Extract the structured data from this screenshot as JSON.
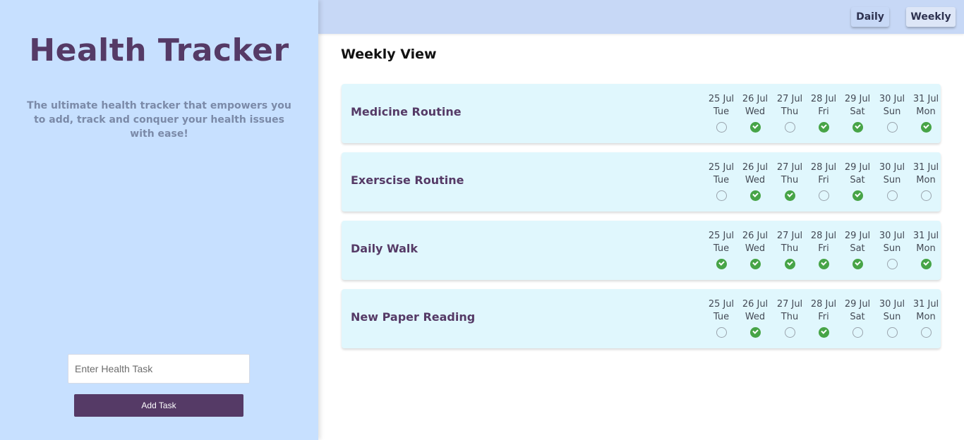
{
  "sidebar": {
    "title": "Health Tracker",
    "tagline": "The ultimate health tracker that empowers you to add, track and conquer your health issues with ease!",
    "input_placeholder": "Enter Health Task",
    "input_value": "",
    "add_button": "Add Task"
  },
  "topbar": {
    "daily_label": "Daily",
    "weekly_label": "Weekly",
    "active_view": "Weekly"
  },
  "main": {
    "heading": "Weekly View"
  },
  "days": [
    {
      "date": "25 Jul",
      "weekday": "Tue"
    },
    {
      "date": "26 Jul",
      "weekday": "Wed"
    },
    {
      "date": "27 Jul",
      "weekday": "Thu"
    },
    {
      "date": "28 Jul",
      "weekday": "Fri"
    },
    {
      "date": "29 Jul",
      "weekday": "Sat"
    },
    {
      "date": "30 Jul",
      "weekday": "Sun"
    },
    {
      "date": "31 Jul",
      "weekday": "Mon"
    }
  ],
  "tasks": [
    {
      "name": "Medicine Routine",
      "status": [
        false,
        true,
        false,
        true,
        true,
        false,
        true
      ]
    },
    {
      "name": "Exerscise Routine",
      "status": [
        false,
        true,
        true,
        false,
        true,
        false,
        false
      ]
    },
    {
      "name": "Daily Walk",
      "status": [
        true,
        true,
        true,
        true,
        true,
        false,
        true
      ]
    },
    {
      "name": "New Paper Reading",
      "status": [
        false,
        true,
        false,
        true,
        false,
        false,
        false
      ]
    }
  ],
  "colors": {
    "sidebar_bg": "#c7e0ff",
    "title": "#553a66",
    "topbar_bg": "#c7d8f6",
    "card_bg": "#e0f7fd",
    "done": "#47a447"
  },
  "icons": {
    "done": "check-circle-icon",
    "pending": "empty-circle-icon"
  }
}
